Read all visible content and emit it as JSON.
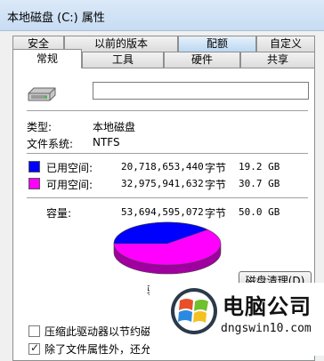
{
  "window": {
    "title": "本地磁盘 (C:) 属性"
  },
  "tabs_back": [
    "安全",
    "以前的版本",
    "配额",
    "自定义"
  ],
  "tabs_front": [
    "常规",
    "工具",
    "硬件",
    "共享"
  ],
  "general": {
    "name_value": "",
    "type_label": "类型:",
    "type_value": "本地磁盘",
    "fs_label": "文件系统:",
    "fs_value": "NTFS",
    "used_label": "已用空间:",
    "used_bytes": "20,718,653,440",
    "used_unit": "字节",
    "used_size": "19.2 GB",
    "free_label": "可用空间:",
    "free_bytes": "32,975,941,632",
    "free_unit": "字节",
    "free_size": "30.7 GB",
    "cap_label": "容量:",
    "cap_bytes": "53,694,595,072",
    "cap_unit": "字节",
    "cap_size": "50.0 GB",
    "drive_label_partial": "驱",
    "cleanup_button": "磁盘清理(D)",
    "compress_label": "压缩此驱动器以节约磁盘",
    "index_label": "除了文件属性外，还允许"
  },
  "colors": {
    "used": "#0000ff",
    "free": "#ff00ff"
  },
  "usage": {
    "used_fraction": 0.386
  },
  "watermark": {
    "title": "电脑公司",
    "url": "dngswin10.com"
  }
}
